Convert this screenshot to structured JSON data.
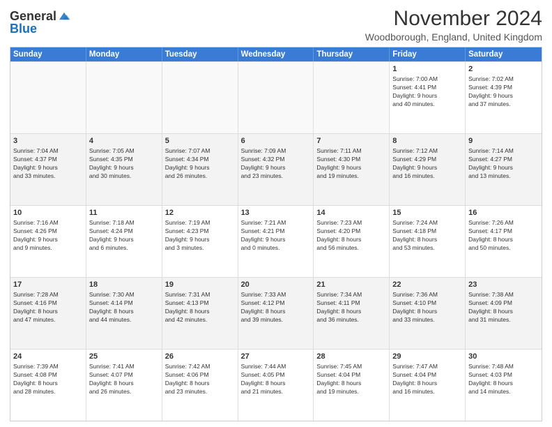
{
  "logo": {
    "general": "General",
    "blue": "Blue"
  },
  "title": "November 2024",
  "location": "Woodborough, England, United Kingdom",
  "headers": [
    "Sunday",
    "Monday",
    "Tuesday",
    "Wednesday",
    "Thursday",
    "Friday",
    "Saturday"
  ],
  "weeks": [
    [
      {
        "day": "",
        "detail": ""
      },
      {
        "day": "",
        "detail": ""
      },
      {
        "day": "",
        "detail": ""
      },
      {
        "day": "",
        "detail": ""
      },
      {
        "day": "",
        "detail": ""
      },
      {
        "day": "1",
        "detail": "Sunrise: 7:00 AM\nSunset: 4:41 PM\nDaylight: 9 hours\nand 40 minutes."
      },
      {
        "day": "2",
        "detail": "Sunrise: 7:02 AM\nSunset: 4:39 PM\nDaylight: 9 hours\nand 37 minutes."
      }
    ],
    [
      {
        "day": "3",
        "detail": "Sunrise: 7:04 AM\nSunset: 4:37 PM\nDaylight: 9 hours\nand 33 minutes."
      },
      {
        "day": "4",
        "detail": "Sunrise: 7:05 AM\nSunset: 4:35 PM\nDaylight: 9 hours\nand 30 minutes."
      },
      {
        "day": "5",
        "detail": "Sunrise: 7:07 AM\nSunset: 4:34 PM\nDaylight: 9 hours\nand 26 minutes."
      },
      {
        "day": "6",
        "detail": "Sunrise: 7:09 AM\nSunset: 4:32 PM\nDaylight: 9 hours\nand 23 minutes."
      },
      {
        "day": "7",
        "detail": "Sunrise: 7:11 AM\nSunset: 4:30 PM\nDaylight: 9 hours\nand 19 minutes."
      },
      {
        "day": "8",
        "detail": "Sunrise: 7:12 AM\nSunset: 4:29 PM\nDaylight: 9 hours\nand 16 minutes."
      },
      {
        "day": "9",
        "detail": "Sunrise: 7:14 AM\nSunset: 4:27 PM\nDaylight: 9 hours\nand 13 minutes."
      }
    ],
    [
      {
        "day": "10",
        "detail": "Sunrise: 7:16 AM\nSunset: 4:26 PM\nDaylight: 9 hours\nand 9 minutes."
      },
      {
        "day": "11",
        "detail": "Sunrise: 7:18 AM\nSunset: 4:24 PM\nDaylight: 9 hours\nand 6 minutes."
      },
      {
        "day": "12",
        "detail": "Sunrise: 7:19 AM\nSunset: 4:23 PM\nDaylight: 9 hours\nand 3 minutes."
      },
      {
        "day": "13",
        "detail": "Sunrise: 7:21 AM\nSunset: 4:21 PM\nDaylight: 9 hours\nand 0 minutes."
      },
      {
        "day": "14",
        "detail": "Sunrise: 7:23 AM\nSunset: 4:20 PM\nDaylight: 8 hours\nand 56 minutes."
      },
      {
        "day": "15",
        "detail": "Sunrise: 7:24 AM\nSunset: 4:18 PM\nDaylight: 8 hours\nand 53 minutes."
      },
      {
        "day": "16",
        "detail": "Sunrise: 7:26 AM\nSunset: 4:17 PM\nDaylight: 8 hours\nand 50 minutes."
      }
    ],
    [
      {
        "day": "17",
        "detail": "Sunrise: 7:28 AM\nSunset: 4:16 PM\nDaylight: 8 hours\nand 47 minutes."
      },
      {
        "day": "18",
        "detail": "Sunrise: 7:30 AM\nSunset: 4:14 PM\nDaylight: 8 hours\nand 44 minutes."
      },
      {
        "day": "19",
        "detail": "Sunrise: 7:31 AM\nSunset: 4:13 PM\nDaylight: 8 hours\nand 42 minutes."
      },
      {
        "day": "20",
        "detail": "Sunrise: 7:33 AM\nSunset: 4:12 PM\nDaylight: 8 hours\nand 39 minutes."
      },
      {
        "day": "21",
        "detail": "Sunrise: 7:34 AM\nSunset: 4:11 PM\nDaylight: 8 hours\nand 36 minutes."
      },
      {
        "day": "22",
        "detail": "Sunrise: 7:36 AM\nSunset: 4:10 PM\nDaylight: 8 hours\nand 33 minutes."
      },
      {
        "day": "23",
        "detail": "Sunrise: 7:38 AM\nSunset: 4:09 PM\nDaylight: 8 hours\nand 31 minutes."
      }
    ],
    [
      {
        "day": "24",
        "detail": "Sunrise: 7:39 AM\nSunset: 4:08 PM\nDaylight: 8 hours\nand 28 minutes."
      },
      {
        "day": "25",
        "detail": "Sunrise: 7:41 AM\nSunset: 4:07 PM\nDaylight: 8 hours\nand 26 minutes."
      },
      {
        "day": "26",
        "detail": "Sunrise: 7:42 AM\nSunset: 4:06 PM\nDaylight: 8 hours\nand 23 minutes."
      },
      {
        "day": "27",
        "detail": "Sunrise: 7:44 AM\nSunset: 4:05 PM\nDaylight: 8 hours\nand 21 minutes."
      },
      {
        "day": "28",
        "detail": "Sunrise: 7:45 AM\nSunset: 4:04 PM\nDaylight: 8 hours\nand 19 minutes."
      },
      {
        "day": "29",
        "detail": "Sunrise: 7:47 AM\nSunset: 4:04 PM\nDaylight: 8 hours\nand 16 minutes."
      },
      {
        "day": "30",
        "detail": "Sunrise: 7:48 AM\nSunset: 4:03 PM\nDaylight: 8 hours\nand 14 minutes."
      }
    ]
  ]
}
